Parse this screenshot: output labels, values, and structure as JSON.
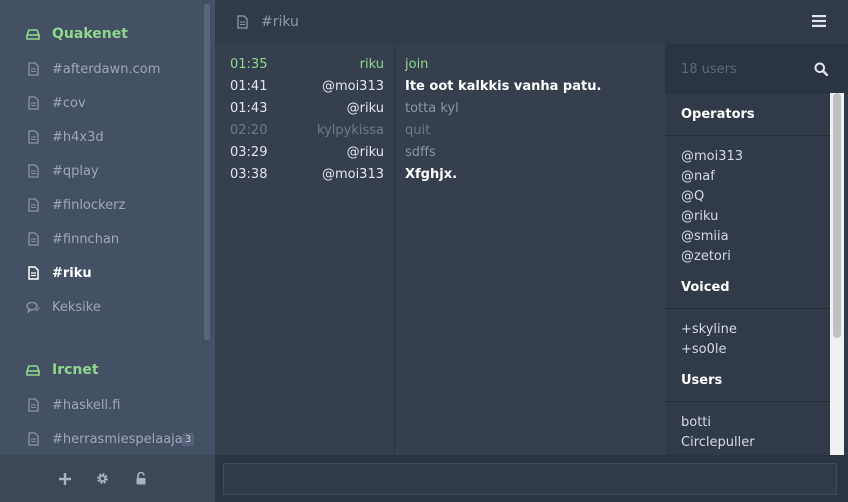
{
  "sidebar": {
    "networks": [
      {
        "name": "Quakenet",
        "channels": [
          {
            "label": "#afterdawn.com",
            "active": false
          },
          {
            "label": "#cov",
            "active": false
          },
          {
            "label": "#h4x3d",
            "active": false
          },
          {
            "label": "#qplay",
            "active": false
          },
          {
            "label": "#finlockerz",
            "active": false
          },
          {
            "label": "#finnchan",
            "active": false
          },
          {
            "label": "#riku",
            "active": true
          },
          {
            "label": "Keksike",
            "active": false,
            "type": "query"
          }
        ]
      },
      {
        "name": "Ircnet",
        "channels": [
          {
            "label": "#haskell.fi",
            "active": false
          },
          {
            "label": "#herrasmiespelaajat",
            "active": false,
            "badge": "3"
          }
        ]
      }
    ],
    "footer": [
      "plus-icon",
      "gear-icon",
      "unlock-icon"
    ]
  },
  "topbar": {
    "title": "#riku"
  },
  "messages": [
    {
      "time": "01:35",
      "nick": "riku",
      "text": "join",
      "kind": "join"
    },
    {
      "time": "01:41",
      "nick": "@moi313",
      "text": "Ite oot kalkkis vanha patu.",
      "kind": "bold"
    },
    {
      "time": "01:43",
      "nick": "@riku",
      "text": "totta kyl",
      "kind": "normal"
    },
    {
      "time": "02:20",
      "nick": "kylpykissa",
      "text": "quit",
      "kind": "faint"
    },
    {
      "time": "03:29",
      "nick": "@riku",
      "text": "sdffs",
      "kind": "normal"
    },
    {
      "time": "03:38",
      "nick": "@moi313",
      "text": "Xfghjx.",
      "kind": "bold"
    }
  ],
  "userlist": {
    "count": "18 users",
    "groups": [
      {
        "title": "Operators",
        "users": [
          "@moi313",
          "@naf",
          "@Q",
          "@riku",
          "@smiia",
          "@zetori"
        ]
      },
      {
        "title": "Voiced",
        "users": [
          "+skyline",
          "+so0le"
        ]
      },
      {
        "title": "Users",
        "users": [
          "botti",
          "Circlepuller"
        ]
      }
    ]
  },
  "input": {
    "value": ""
  },
  "colors": {
    "accent": "#8fd78d",
    "sidebar_bg": "#445164",
    "main_bg": "#363f4e",
    "topbar_bg": "#303a49"
  }
}
